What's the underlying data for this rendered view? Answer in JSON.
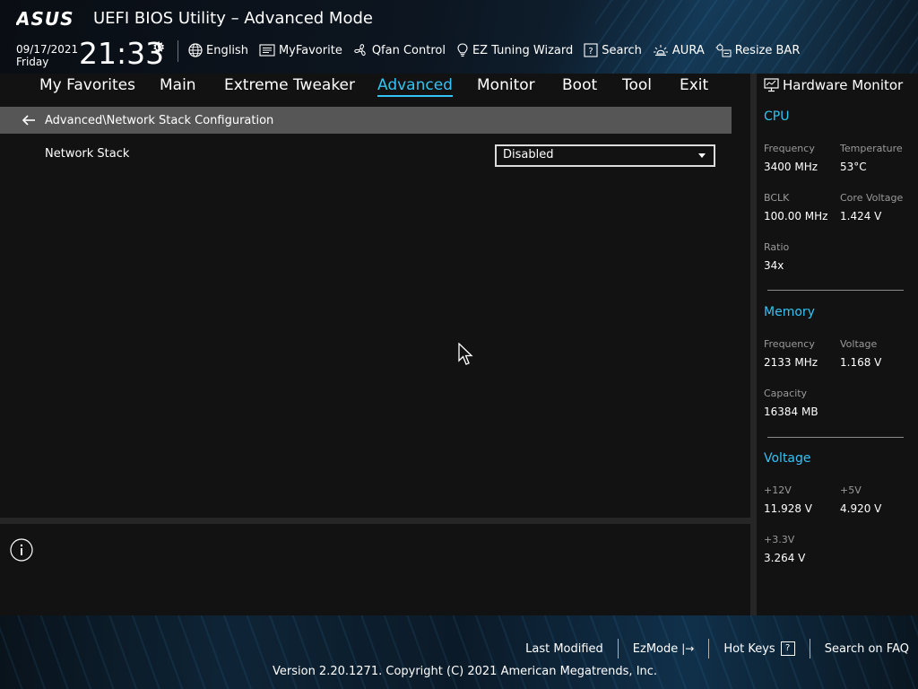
{
  "header": {
    "brand": "ASUS",
    "title": "UEFI BIOS Utility – Advanced Mode",
    "date": "09/17/2021",
    "day": "Friday",
    "time": "21:33",
    "toolbar": [
      {
        "label": "English",
        "icon": "globe-icon"
      },
      {
        "label": "MyFavorite",
        "icon": "favorite-list-icon"
      },
      {
        "label": "Qfan Control",
        "icon": "fan-icon"
      },
      {
        "label": "EZ Tuning Wizard",
        "icon": "lightbulb-icon"
      },
      {
        "label": "Search",
        "icon": "question-box-icon"
      },
      {
        "label": "AURA",
        "icon": "aura-light-icon"
      },
      {
        "label": "Resize BAR",
        "icon": "resize-bar-icon"
      }
    ]
  },
  "nav": {
    "tabs": [
      {
        "label": "My Favorites"
      },
      {
        "label": "Main"
      },
      {
        "label": "Extreme Tweaker"
      },
      {
        "label": "Advanced"
      },
      {
        "label": "Monitor"
      },
      {
        "label": "Boot"
      },
      {
        "label": "Tool"
      },
      {
        "label": "Exit"
      }
    ],
    "active": "Advanced"
  },
  "breadcrumb": {
    "path": "Advanced\\Network Stack Configuration"
  },
  "settings": [
    {
      "label": "Network Stack",
      "value": "Disabled"
    }
  ],
  "hardware_monitor": {
    "title": "Hardware Monitor",
    "cpu": {
      "heading": "CPU",
      "frequency_label": "Frequency",
      "frequency": "3400 MHz",
      "temperature_label": "Temperature",
      "temperature": "53°C",
      "bclk_label": "BCLK",
      "bclk": "100.00 MHz",
      "core_voltage_label": "Core Voltage",
      "core_voltage": "1.424 V",
      "ratio_label": "Ratio",
      "ratio": "34x"
    },
    "memory": {
      "heading": "Memory",
      "frequency_label": "Frequency",
      "frequency": "2133 MHz",
      "voltage_label": "Voltage",
      "voltage": "1.168 V",
      "capacity_label": "Capacity",
      "capacity": "16384 MB"
    },
    "voltage": {
      "heading": "Voltage",
      "v12_label": "+12V",
      "v12": "11.928 V",
      "v5_label": "+5V",
      "v5": "4.920 V",
      "v33_label": "+3.3V",
      "v33": "3.264 V"
    }
  },
  "footer": {
    "last_modified": "Last Modified",
    "ezmode": "EzMode",
    "ezmode_key": "|→",
    "hot_keys": "Hot Keys",
    "hot_keys_key": "?",
    "search_faq": "Search on FAQ",
    "copyright": "Version 2.20.1271. Copyright (C) 2021 American Megatrends, Inc."
  },
  "colors": {
    "accent": "#34c3f4",
    "breadcrumb_bg": "#565656",
    "background": "#121212"
  }
}
